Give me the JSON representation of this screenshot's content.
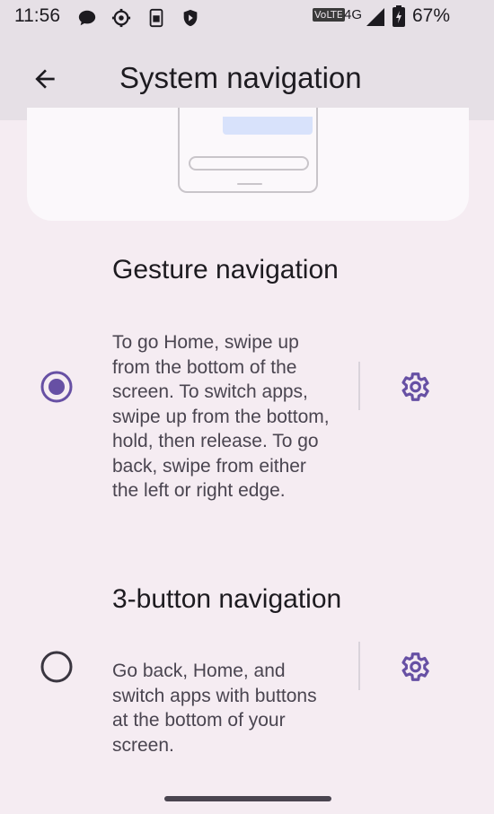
{
  "status_bar": {
    "time": "11:56",
    "network_label": "VoLTE",
    "network_type": "4G",
    "battery": "67%",
    "icons": [
      "message-icon",
      "settings-icon",
      "sd-card-icon",
      "shield-icon"
    ]
  },
  "app_bar": {
    "title": "System navigation",
    "back_icon": "arrow-back-icon"
  },
  "options": [
    {
      "title": "Gesture navigation",
      "description": "To go Home, swipe up from the bottom of the screen. To switch apps, swipe up from the bottom, hold, then release. To go back, swipe from either the left or right edge.",
      "selected": true
    },
    {
      "title": "3-button navigation",
      "description": "Go back, Home, and switch apps with buttons at the bottom of your screen.",
      "selected": false
    }
  ],
  "colors": {
    "accent": "#6750a4",
    "background": "#f5ecf2",
    "app_bar": "#e6e0e6"
  }
}
